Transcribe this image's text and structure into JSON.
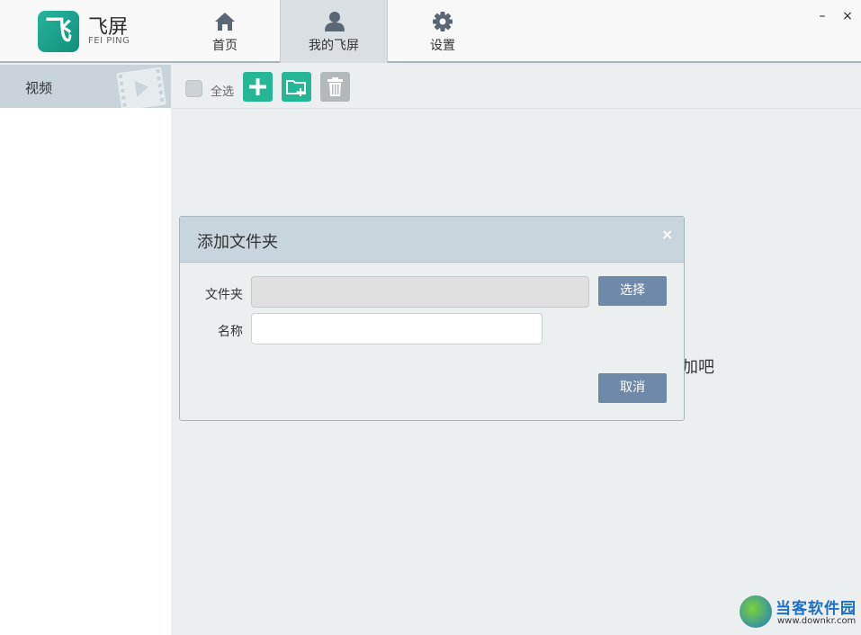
{
  "app": {
    "name": "飞屏",
    "name_sub": "FEI PING",
    "logo_glyph": "飞"
  },
  "nav": {
    "items": [
      {
        "label": "首页",
        "icon": "home-icon"
      },
      {
        "label": "我的飞屏",
        "icon": "user-icon",
        "active": true
      },
      {
        "label": "设置",
        "icon": "gear-icon"
      }
    ]
  },
  "window": {
    "minimize": "–",
    "close": "×"
  },
  "sidebar": {
    "items": [
      {
        "label": "视频",
        "icon": "film-icon",
        "selected": true
      }
    ]
  },
  "toolbar": {
    "select_all": "全选",
    "add_icon": "plus-icon",
    "add_folder_icon": "folder-plus-icon",
    "delete_icon": "trash-icon"
  },
  "main": {
    "hint_text": "加吧"
  },
  "dialog": {
    "title": "添加文件夹",
    "close": "×",
    "folder_label": "文件夹",
    "folder_value": "",
    "name_label": "名称",
    "name_value": "",
    "select_button": "选择",
    "cancel_button": "取消"
  },
  "watermark": {
    "text": "当客软件园",
    "url": "www.downkr.com"
  },
  "colors": {
    "accent_green": "#25b795",
    "dialog_button": "#6f8aa8",
    "header_active": "#d9dfe3"
  }
}
